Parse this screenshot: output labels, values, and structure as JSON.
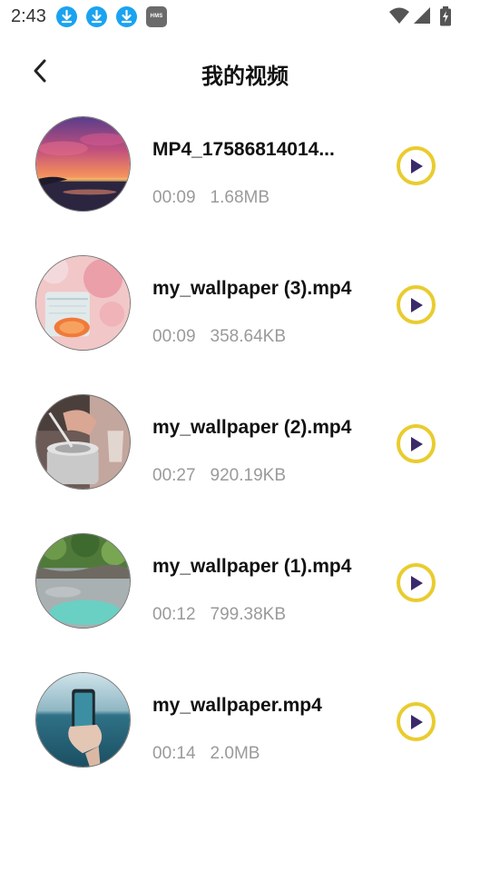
{
  "status_bar": {
    "time": "2:43",
    "badge": "HMS",
    "notification_icons": [
      "download-icon",
      "download-icon",
      "download-icon",
      "hms-icon"
    ],
    "system_icons": [
      "wifi-icon",
      "signal-icon",
      "battery-icon"
    ]
  },
  "header": {
    "title": "我的视频",
    "back_icon": "chevron-left-icon"
  },
  "colors": {
    "accent": "#e9cc2f",
    "play_triangle": "#3a2a6a",
    "meta_text": "#9a9a9a",
    "notif_badge": "#1aa3f0"
  },
  "videos": [
    {
      "name": "MP4_17586814014...",
      "duration": "00:09",
      "size": "1.68MB",
      "thumbnail": "sunset-over-sea"
    },
    {
      "name": "my_wallpaper (3).mp4",
      "duration": "00:09",
      "size": "358.64KB",
      "thumbnail": "drink-glass-with-citrus"
    },
    {
      "name": "my_wallpaper (2).mp4",
      "duration": "00:27",
      "size": "920.19KB",
      "thumbnail": "hands-with-metal-pot"
    },
    {
      "name": "my_wallpaper (1).mp4",
      "duration": "00:12",
      "size": "799.38KB",
      "thumbnail": "aerial-coast-turquoise-water"
    },
    {
      "name": "my_wallpaper.mp4",
      "duration": "00:14",
      "size": "2.0MB",
      "thumbnail": "hand-holding-phone-at-sea"
    }
  ]
}
